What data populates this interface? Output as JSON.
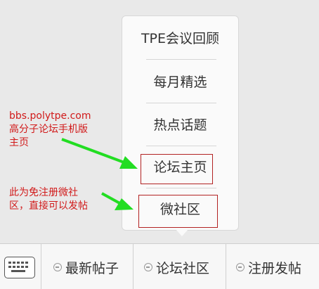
{
  "popup_menu": {
    "items": [
      {
        "label": "TPE会议回顾"
      },
      {
        "label": "每月精选"
      },
      {
        "label": "热点话题"
      },
      {
        "label": "论坛主页"
      },
      {
        "label": "微社区"
      }
    ]
  },
  "annotations": {
    "forum_home_note": [
      "bbs.polytpe.com",
      "高分子论坛手机版",
      "主页"
    ],
    "micro_community_note": [
      "此为免注册微社",
      "区，直接可以发帖"
    ]
  },
  "bottom_bar": {
    "tabs": [
      {
        "label": "最新帖子",
        "icon": "minus-circle-icon"
      },
      {
        "label": "论坛社区",
        "icon": "minus-circle-icon"
      },
      {
        "label": "注册发帖",
        "icon": "minus-circle-icon"
      }
    ],
    "keyboard_icon": "keyboard-icon"
  },
  "colors": {
    "annotation_red": "#d11a1a",
    "arrow_green": "#22dd22",
    "highlight_box": "#b22222"
  }
}
